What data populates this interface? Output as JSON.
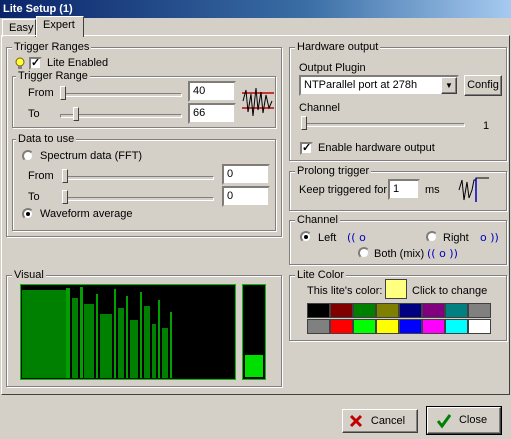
{
  "window": {
    "title": "Lite Setup (1)"
  },
  "tabs": [
    {
      "label": "Easy"
    },
    {
      "label": "Expert"
    }
  ],
  "trigger_ranges": {
    "group_label": "Trigger Ranges",
    "lite_enabled_label": "Lite Enabled",
    "lite_enabled": true,
    "trigger_range": {
      "group_label": "Trigger Range",
      "from_label": "From",
      "from_value": "40",
      "to_label": "To",
      "to_value": "66"
    },
    "data_to_use": {
      "group_label": "Data to use",
      "spectrum_label": "Spectrum data (FFT)",
      "from_label": "From",
      "from_value": "0",
      "to_label": "To",
      "to_value": "0",
      "waveform_label": "Waveform average",
      "selected": "waveform"
    }
  },
  "hardware_output": {
    "group_label": "Hardware output",
    "plugin_label": "Output Plugin",
    "plugin_value": "NTParallel port at 278h",
    "config_label": "Config",
    "channel_label": "Channel",
    "channel_value": "1",
    "enable_label": "Enable hardware output",
    "enabled": true
  },
  "prolong_trigger": {
    "group_label": "Prolong trigger",
    "keep_label": "Keep triggered for",
    "keep_value": "1",
    "unit": "ms"
  },
  "channel": {
    "group_label": "Channel",
    "left_label": "Left",
    "right_label": "Right",
    "both_label": "Both (mix)",
    "selected": "left"
  },
  "lite_color": {
    "group_label": "Lite Color",
    "this_color_label": "This lite's color:",
    "current_color": "#ffff80",
    "click_label": "Click to change",
    "palette": [
      "#000000",
      "#800000",
      "#008000",
      "#808000",
      "#000080",
      "#800080",
      "#008080",
      "#808080",
      "#808080",
      "#ff0000",
      "#00ff00",
      "#ffff00",
      "#0000ff",
      "#ff00ff",
      "#00ffff",
      "#ffffff"
    ]
  },
  "visual": {
    "group_label": "Visual",
    "level": 0.23
  },
  "footer": {
    "cancel_label": "Cancel",
    "close_label": "Close"
  }
}
